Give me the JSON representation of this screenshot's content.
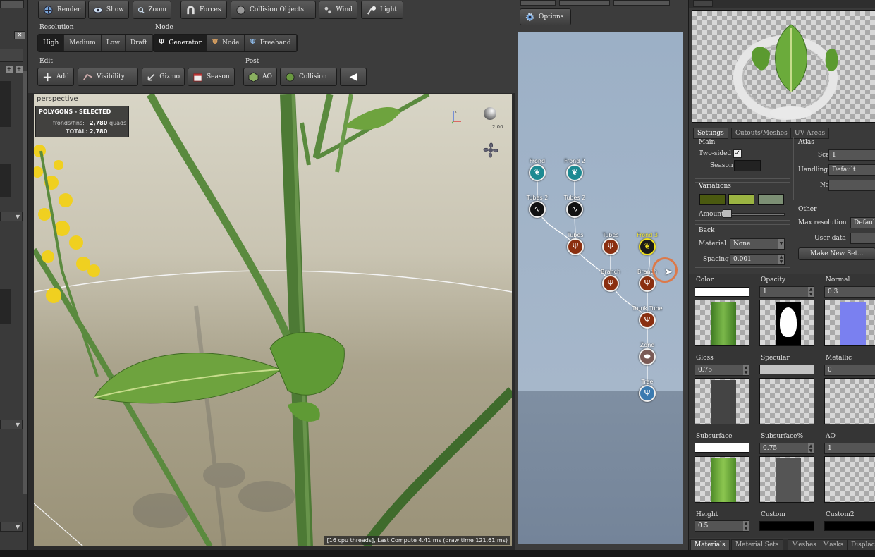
{
  "toolbar": {
    "render": "Render",
    "show": "Show",
    "zoom": "Zoom",
    "forces": "Forces",
    "collision_objects": "Collision Objects",
    "wind": "Wind",
    "light": "Light",
    "resolution_label": "Resolution",
    "mode_label": "Mode",
    "resolution": [
      "High",
      "Medium",
      "Low",
      "Draft"
    ],
    "mode": [
      "Generator",
      "Node",
      "Freehand"
    ],
    "edit_label": "Edit",
    "post_label": "Post",
    "edit": [
      "Add",
      "Visibility",
      "Gizmo",
      "Season"
    ],
    "post": [
      "AO",
      "Collision"
    ]
  },
  "viewport": {
    "view_name": "perspective",
    "stats_title": "POLYGONS - SELECTED",
    "stats_row1_label": "fronds/fins:",
    "stats_row1_value": "2,780",
    "stats_row1_unit": "quads",
    "stats_row2_label": "TOTAL:",
    "stats_row2_value": "2,780",
    "zoom_value": "2.00",
    "status": "[16 cpu threads], Last Compute 4.41 ms (draw time 121.61 ms)"
  },
  "graph": {
    "options": "Options",
    "nodes": [
      {
        "label": "Frond",
        "kind": "frond"
      },
      {
        "label": "Frond 2",
        "kind": "frond"
      },
      {
        "label": "Tubes 2",
        "kind": "tube"
      },
      {
        "label": "Tubes 2",
        "kind": "tube"
      },
      {
        "label": "Tubes",
        "kind": "branch"
      },
      {
        "label": "Tubes",
        "kind": "branch"
      },
      {
        "label": "Frond 3",
        "kind": "frond-selected"
      },
      {
        "label": "Branch",
        "kind": "branch"
      },
      {
        "label": "Branch",
        "kind": "branch"
      },
      {
        "label": "Trunk Tube",
        "kind": "branch"
      },
      {
        "label": "Zone",
        "kind": "zone"
      },
      {
        "label": "Tree",
        "kind": "tree"
      }
    ]
  },
  "material": {
    "tabs": [
      "Settings",
      "Cutouts/Meshes",
      "UV Areas"
    ],
    "main_label": "Main",
    "two_sided": "Two-sided",
    "season": "Season",
    "atlas_label": "Atlas",
    "scale": "Scale",
    "scale_value": "1",
    "handling": "Handling",
    "handling_value": "Default",
    "name": "Name",
    "variations_label": "Variations",
    "amount": "Amount",
    "variation_colors": [
      "#4b5a10",
      "#9bb442",
      "#7c8f74"
    ],
    "other_label": "Other",
    "max_resolution": "Max resolution",
    "max_resolution_value": "Defaul",
    "user_data": "User data",
    "make_new_set": "Make New Set...",
    "back_label": "Back",
    "material": "Material",
    "material_value": "None",
    "spacing": "Spacing",
    "spacing_value": "0.001",
    "maps": [
      {
        "name": "Color",
        "value": ""
      },
      {
        "name": "Opacity",
        "value": "1"
      },
      {
        "name": "Normal",
        "value": "0.3"
      },
      {
        "name": "Gloss",
        "value": "0.75"
      },
      {
        "name": "Specular",
        "value": ""
      },
      {
        "name": "Metallic",
        "value": "0"
      },
      {
        "name": "Subsurface",
        "value": ""
      },
      {
        "name": "Subsurface%",
        "value": "0.75"
      },
      {
        "name": "AO",
        "value": "1"
      },
      {
        "name": "Height",
        "value": "0.5"
      },
      {
        "name": "Custom",
        "value": ""
      },
      {
        "name": "Custom2",
        "value": ""
      }
    ],
    "bottom_tabs": [
      "Materials",
      "Material Sets",
      "Meshes",
      "Masks",
      "Displac"
    ]
  }
}
